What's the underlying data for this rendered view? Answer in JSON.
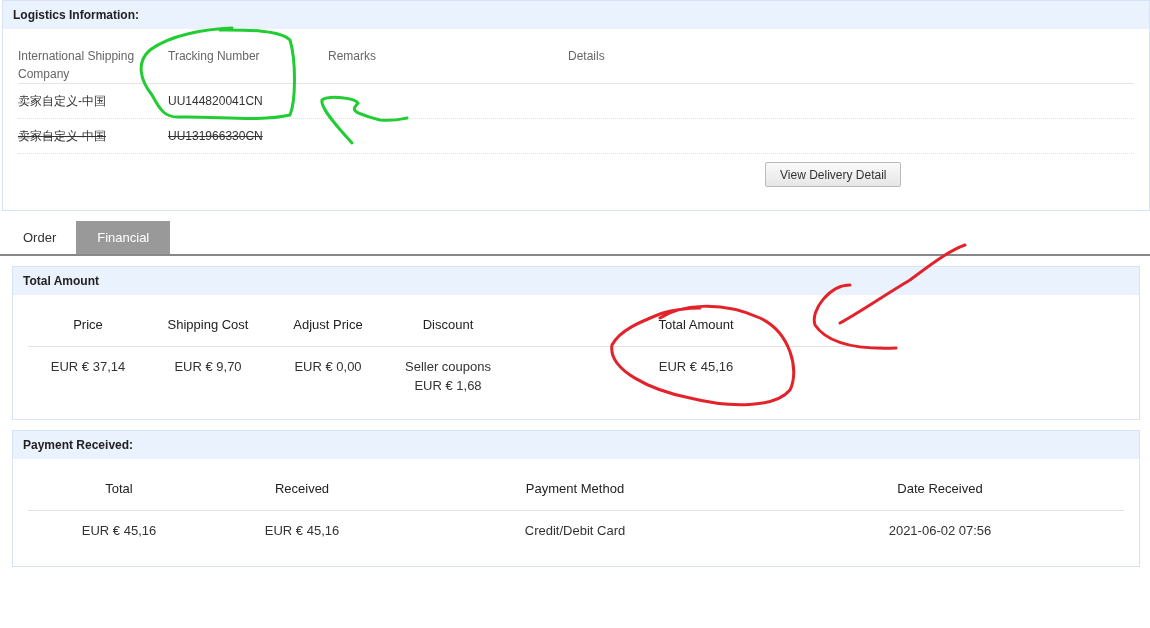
{
  "logistics": {
    "title": "Logistics Information:",
    "columns": [
      "International Shipping Company",
      "Tracking Number",
      "Remarks",
      "Details"
    ],
    "rows": [
      {
        "company": "卖家自定义-中国",
        "tracking": "UU144820041CN",
        "struck": false
      },
      {
        "company": "卖家自定义-中国",
        "tracking": "UU131966330CN",
        "struck": true
      }
    ],
    "button": "View Delivery Detail"
  },
  "tabs": [
    {
      "label": "Order",
      "selected": false
    },
    {
      "label": "Financial",
      "selected": true
    }
  ],
  "total_amount": {
    "title": "Total Amount",
    "columns": [
      "Price",
      "Shipping Cost",
      "Adjust Price",
      "Discount",
      "Total Amount"
    ],
    "row": [
      "EUR € 37,14",
      "EUR € 9,70",
      "EUR € 0,00",
      [
        "Seller coupons",
        "EUR € 1,68"
      ],
      "EUR € 45,16"
    ]
  },
  "payment": {
    "title": "Payment Received:",
    "columns": [
      "Total",
      "Received",
      "Payment Method",
      "Date Received"
    ],
    "row": [
      "EUR € 45,16",
      "EUR € 45,16",
      "Credit/Debit Card",
      "2021-06-02 07:56"
    ]
  }
}
